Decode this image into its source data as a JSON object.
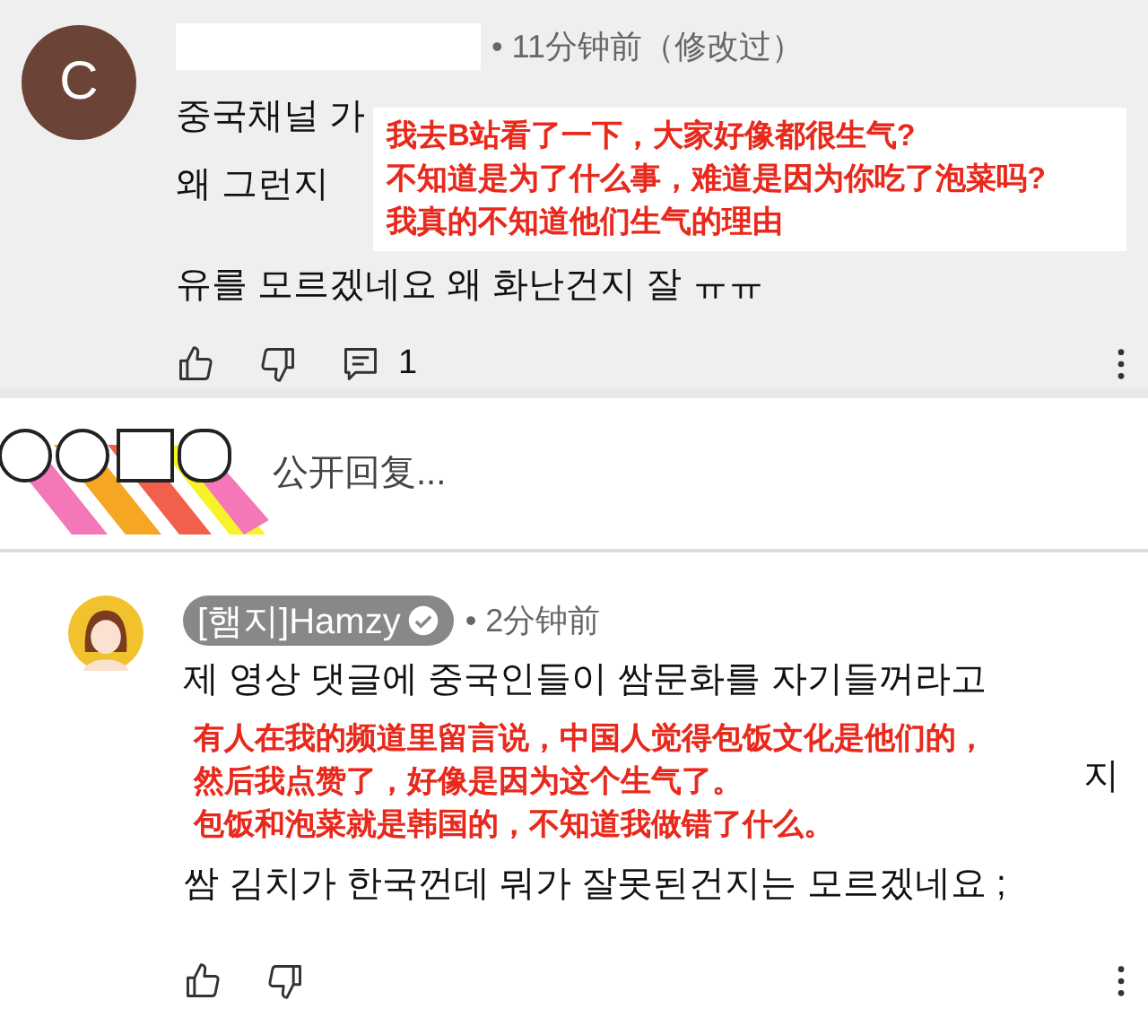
{
  "first_comment": {
    "avatar_letter": "C",
    "meta": "• 11分钟前（修改过）",
    "visible_lines": [
      "중국채널 가",
      "왜 그런지"
    ],
    "note_lines": [
      "我去B站看了一下，大家好像都很生气?",
      "不知道是为了什么事，难道是因为你吃了泡菜吗?",
      "我真的不知道他们生气的理由"
    ],
    "last_line": "유를 모르겠네요 왜 화난건지 잘 ㅠㅠ",
    "reply_count": "1"
  },
  "reply_box": {
    "placeholder": "公开回复..."
  },
  "second_comment": {
    "author": "[햄지]Hamzy",
    "verified": true,
    "meta": "• 2分钟前",
    "first_line": "제 영상 댓글에 중국인들이 쌈문화를 자기들꺼라고",
    "note_lines": [
      "有人在我的频道里留言说，中国人觉得包饭文化是他们的，",
      "然后我点赞了，好像是因为这个生气了。",
      "包饭和泡菜就是韩国的，不知道我做错了什么。"
    ],
    "side_fragment": "지",
    "last_line": "쌈 김치가 한국껀데 뭐가 잘못된건지는 모르겠네요 ;"
  }
}
